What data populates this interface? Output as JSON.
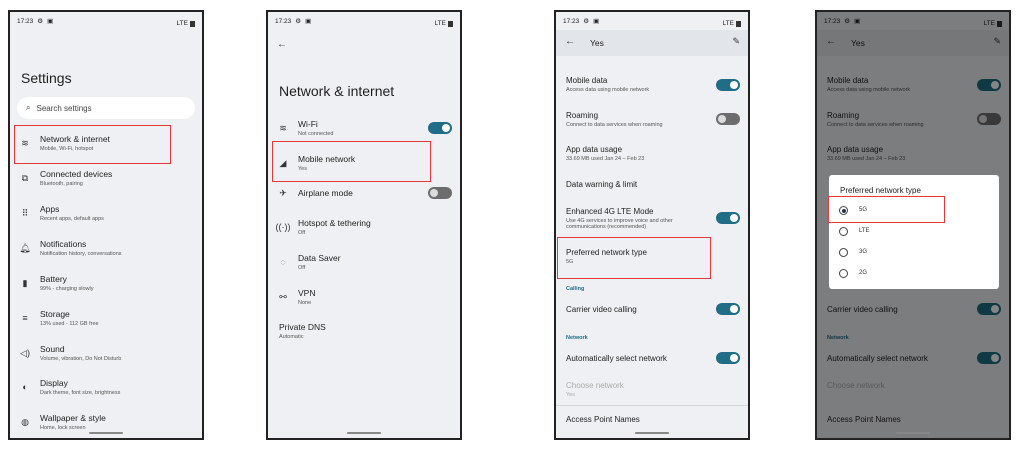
{
  "status_time": "17:23",
  "status_icons": [
    "gear-icon",
    "cast-icon",
    "wifi-call-icon",
    "lte-icon",
    "battery-icon"
  ],
  "status_lte": "LTE",
  "colors": {
    "toggle_on": "#1f6d86",
    "highlight": "#e53935",
    "section": "#1f6d86"
  },
  "screen1": {
    "title": "Settings",
    "search_placeholder": "Search settings",
    "items": [
      {
        "icon": "wifi-icon",
        "title": "Network & internet",
        "subtitle": "Mobile, Wi-Fi, hotspot"
      },
      {
        "icon": "devices-icon",
        "title": "Connected devices",
        "subtitle": "Bluetooth, pairing"
      },
      {
        "icon": "apps-icon",
        "title": "Apps",
        "subtitle": "Recent apps, default apps"
      },
      {
        "icon": "bell-icon",
        "title": "Notifications",
        "subtitle": "Notification history, conversations"
      },
      {
        "icon": "battery-icon",
        "title": "Battery",
        "subtitle": "99% - charging slowly"
      },
      {
        "icon": "storage-icon",
        "title": "Storage",
        "subtitle": "13% used - 112 GB free"
      },
      {
        "icon": "volume-icon",
        "title": "Sound",
        "subtitle": "Volume, vibration, Do Not Disturb"
      },
      {
        "icon": "display-icon",
        "title": "Display",
        "subtitle": "Dark theme, font size, brightness"
      },
      {
        "icon": "palette-icon",
        "title": "Wallpaper & style",
        "subtitle": "Home, lock screen"
      }
    ]
  },
  "screen2": {
    "title": "Network & internet",
    "items": [
      {
        "icon": "wifi-icon",
        "title": "Wi-Fi",
        "subtitle": "Not connected",
        "toggle": "on"
      },
      {
        "icon": "signal-icon",
        "title": "Mobile network",
        "subtitle": "Yes"
      },
      {
        "icon": "airplane-icon",
        "title": "Airplane mode",
        "subtitle": "",
        "toggle": "off"
      },
      {
        "icon": "hotspot-icon",
        "title": "Hotspot & tethering",
        "subtitle": "Off"
      },
      {
        "icon": "data-saver-icon",
        "title": "Data Saver",
        "subtitle": "Off"
      },
      {
        "icon": "vpn-icon",
        "title": "VPN",
        "subtitle": "None"
      },
      {
        "icon": "",
        "title": "Private DNS",
        "subtitle": "Automatic"
      }
    ]
  },
  "screen3": {
    "title": "Yes",
    "mobile_data": {
      "title": "Mobile data",
      "subtitle": "Access data using mobile network",
      "toggle": "on"
    },
    "roaming": {
      "title": "Roaming",
      "subtitle": "Connect to data services when roaming",
      "toggle": "off"
    },
    "app_data": {
      "title": "App data usage",
      "subtitle": "33.69 MB used Jan 24 – Feb 23"
    },
    "warning": {
      "title": "Data warning & limit"
    },
    "lte_mode": {
      "title": "Enhanced 4G LTE Mode",
      "subtitle": "Use 4G services to improve voice and other communications (recommended)",
      "toggle": "on"
    },
    "pref_net": {
      "title": "Preferred network type",
      "subtitle": "5G"
    },
    "calling_section": "Calling",
    "carrier_video": {
      "title": "Carrier video calling",
      "toggle": "on"
    },
    "network_section": "Network",
    "auto_select": {
      "title": "Automatically select network",
      "toggle": "on"
    },
    "choose_net": {
      "title": "Choose network",
      "subtitle": "Yes"
    },
    "apn": {
      "title": "Access Point Names"
    }
  },
  "screen4": {
    "dialog_title": "Preferred network type",
    "options": [
      "5G",
      "LTE",
      "3G",
      "2G"
    ],
    "selected": "5G"
  }
}
